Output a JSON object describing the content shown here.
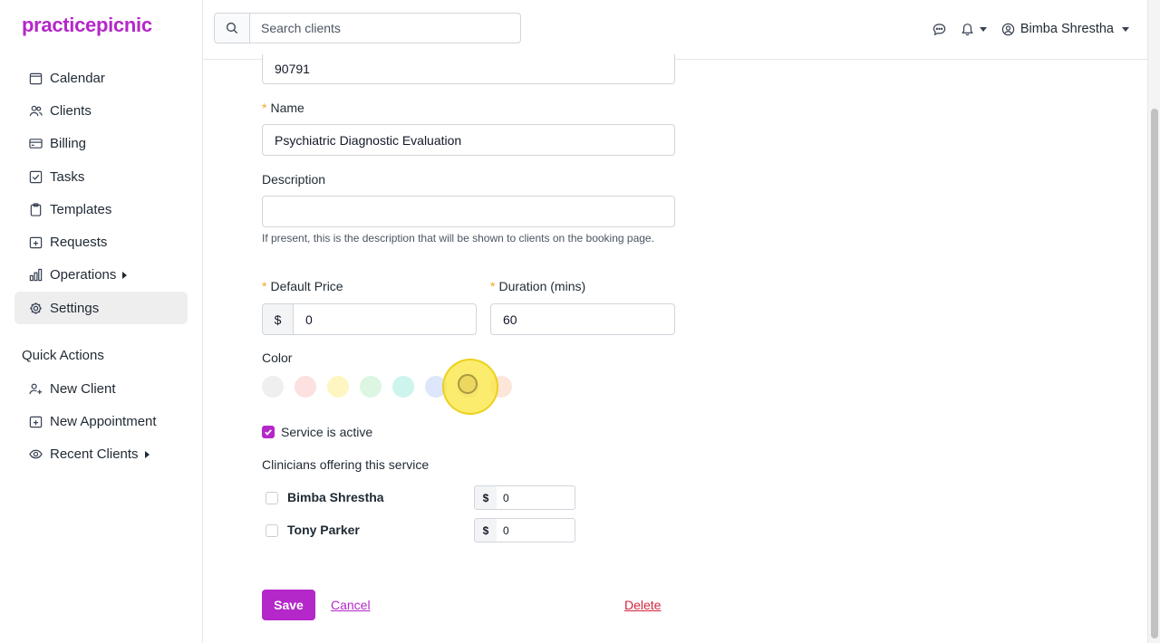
{
  "app": {
    "logo": "practicepicnic",
    "brand_color": "#b427c9"
  },
  "sidebar": {
    "items": [
      {
        "label": "Calendar",
        "icon": "calendar-icon"
      },
      {
        "label": "Clients",
        "icon": "users-icon"
      },
      {
        "label": "Billing",
        "icon": "credit-card-icon"
      },
      {
        "label": "Tasks",
        "icon": "checkbox-icon"
      },
      {
        "label": "Templates",
        "icon": "clipboard-icon"
      },
      {
        "label": "Requests",
        "icon": "calendar-plus-icon"
      },
      {
        "label": "Operations",
        "icon": "bar-chart-icon"
      },
      {
        "label": "Settings",
        "icon": "gear-icon",
        "active": true
      }
    ],
    "quick_actions_heading": "Quick Actions",
    "quick_actions": [
      {
        "label": "New Client",
        "icon": "user-plus-icon"
      },
      {
        "label": "New Appointment",
        "icon": "calendar-plus-icon"
      },
      {
        "label": "Recent Clients",
        "icon": "eye-icon"
      }
    ]
  },
  "header": {
    "search_placeholder": "Search clients",
    "user_name": "Bimba Shrestha"
  },
  "form": {
    "code_value": "90791",
    "name_label": "Name",
    "name_value": "Psychiatric Diagnostic Evaluation",
    "description_label": "Description",
    "description_value": "",
    "description_hint": "If present, this is the description that will be shown to clients on the booking page.",
    "price_label": "Default Price",
    "price_prefix": "$",
    "price_value": "0",
    "duration_label": "Duration (mins)",
    "duration_value": "60",
    "color_label": "Color",
    "colors": [
      "#efefef",
      "#fde0e0",
      "#fdf6c3",
      "#dcf6e2",
      "#cdf5ee",
      "#dde6fb",
      "#f1e1f7",
      "#fde6d9"
    ],
    "active_label": "Service is active",
    "active_checked": true,
    "clinicians_label": "Clinicians offering this service",
    "clinicians": [
      {
        "name": "Bimba Shrestha",
        "prefix": "$",
        "value": "0"
      },
      {
        "name": "Tony Parker",
        "prefix": "$",
        "value": "0"
      }
    ],
    "save_label": "Save",
    "cancel_label": "Cancel",
    "delete_label": "Delete"
  }
}
